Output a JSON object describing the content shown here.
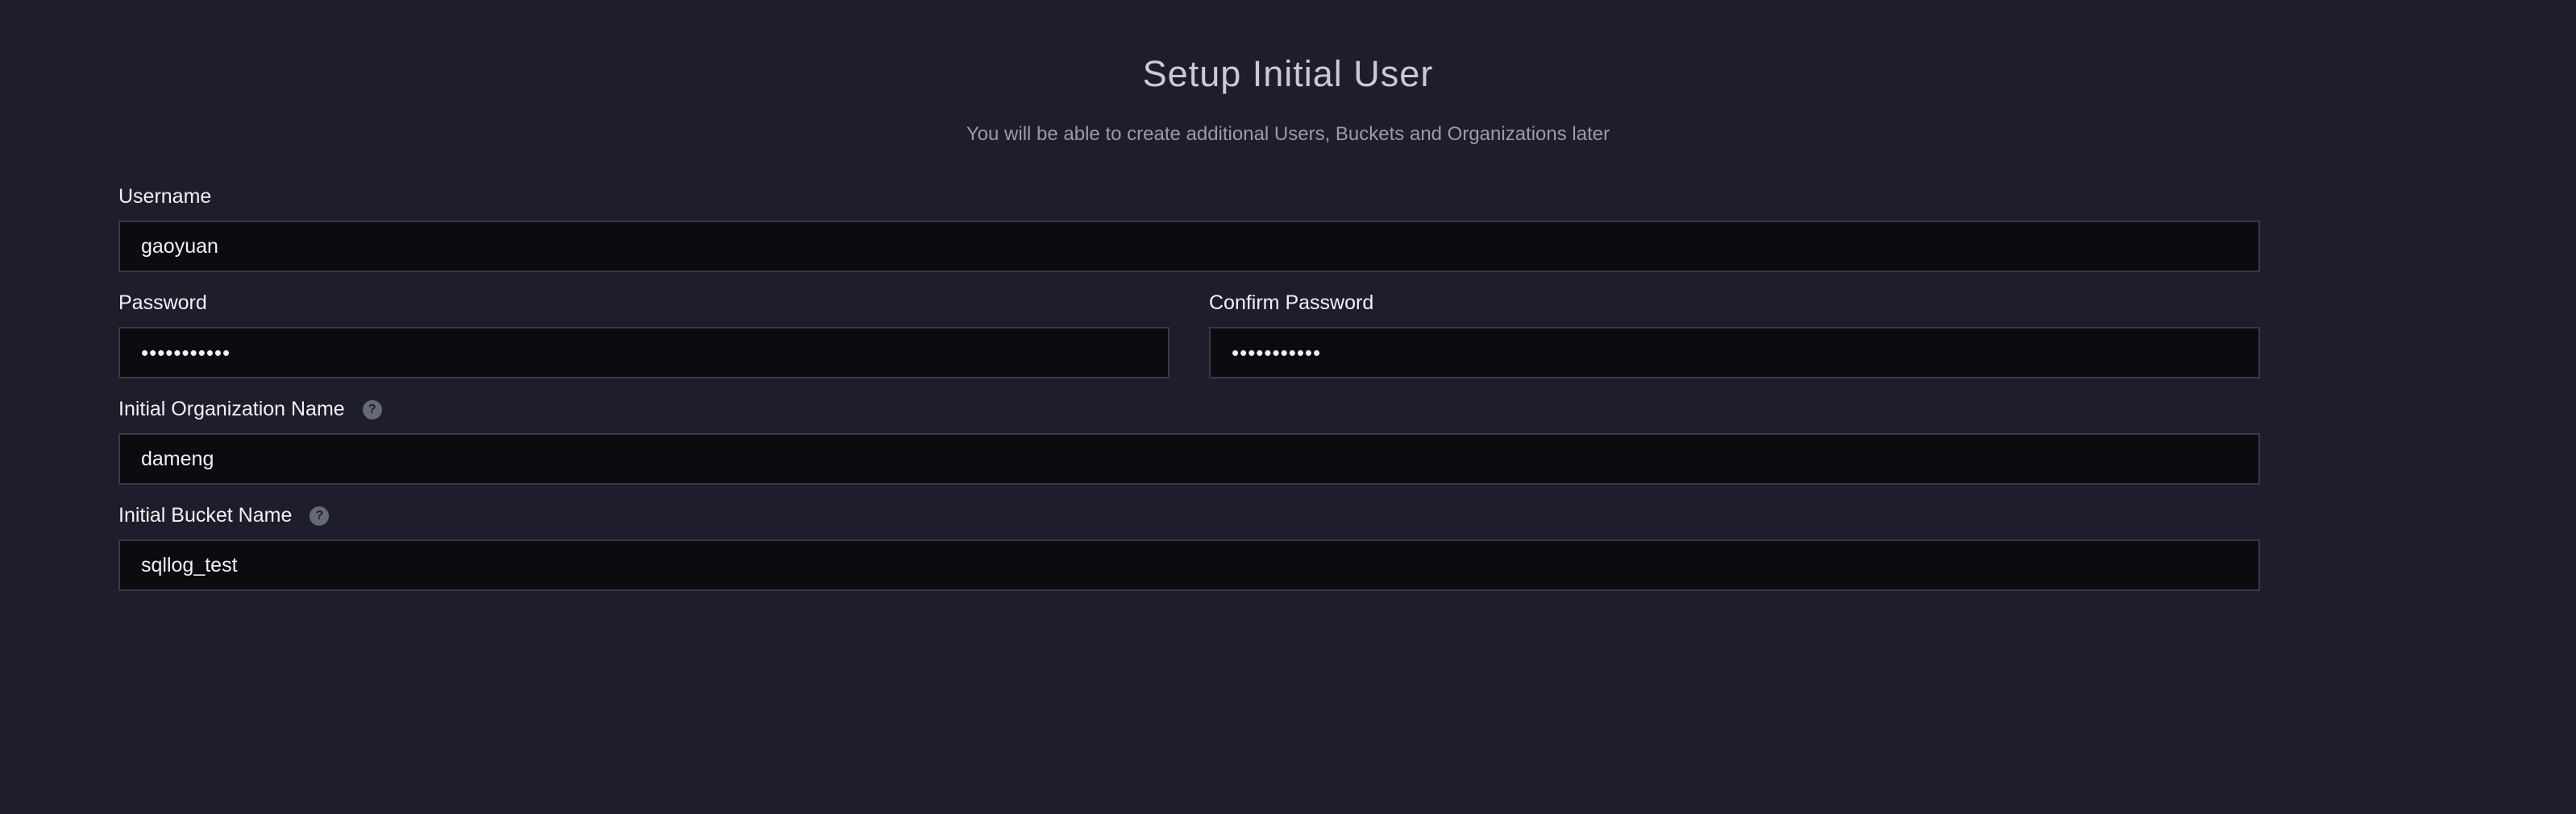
{
  "header": {
    "title": "Setup Initial User",
    "subtitle": "You will be able to create additional Users, Buckets and Organizations later"
  },
  "form": {
    "username": {
      "label": "Username",
      "value": "gaoyuan"
    },
    "password": {
      "label": "Password",
      "value": "•••••••••••"
    },
    "confirm_password": {
      "label": "Confirm Password",
      "value": "•••••••••••"
    },
    "org_name": {
      "label": "Initial Organization Name",
      "value": "dameng",
      "help_icon": "question-icon"
    },
    "bucket_name": {
      "label": "Initial Bucket Name",
      "value": "sqllog_test",
      "help_icon": "question-icon"
    }
  }
}
